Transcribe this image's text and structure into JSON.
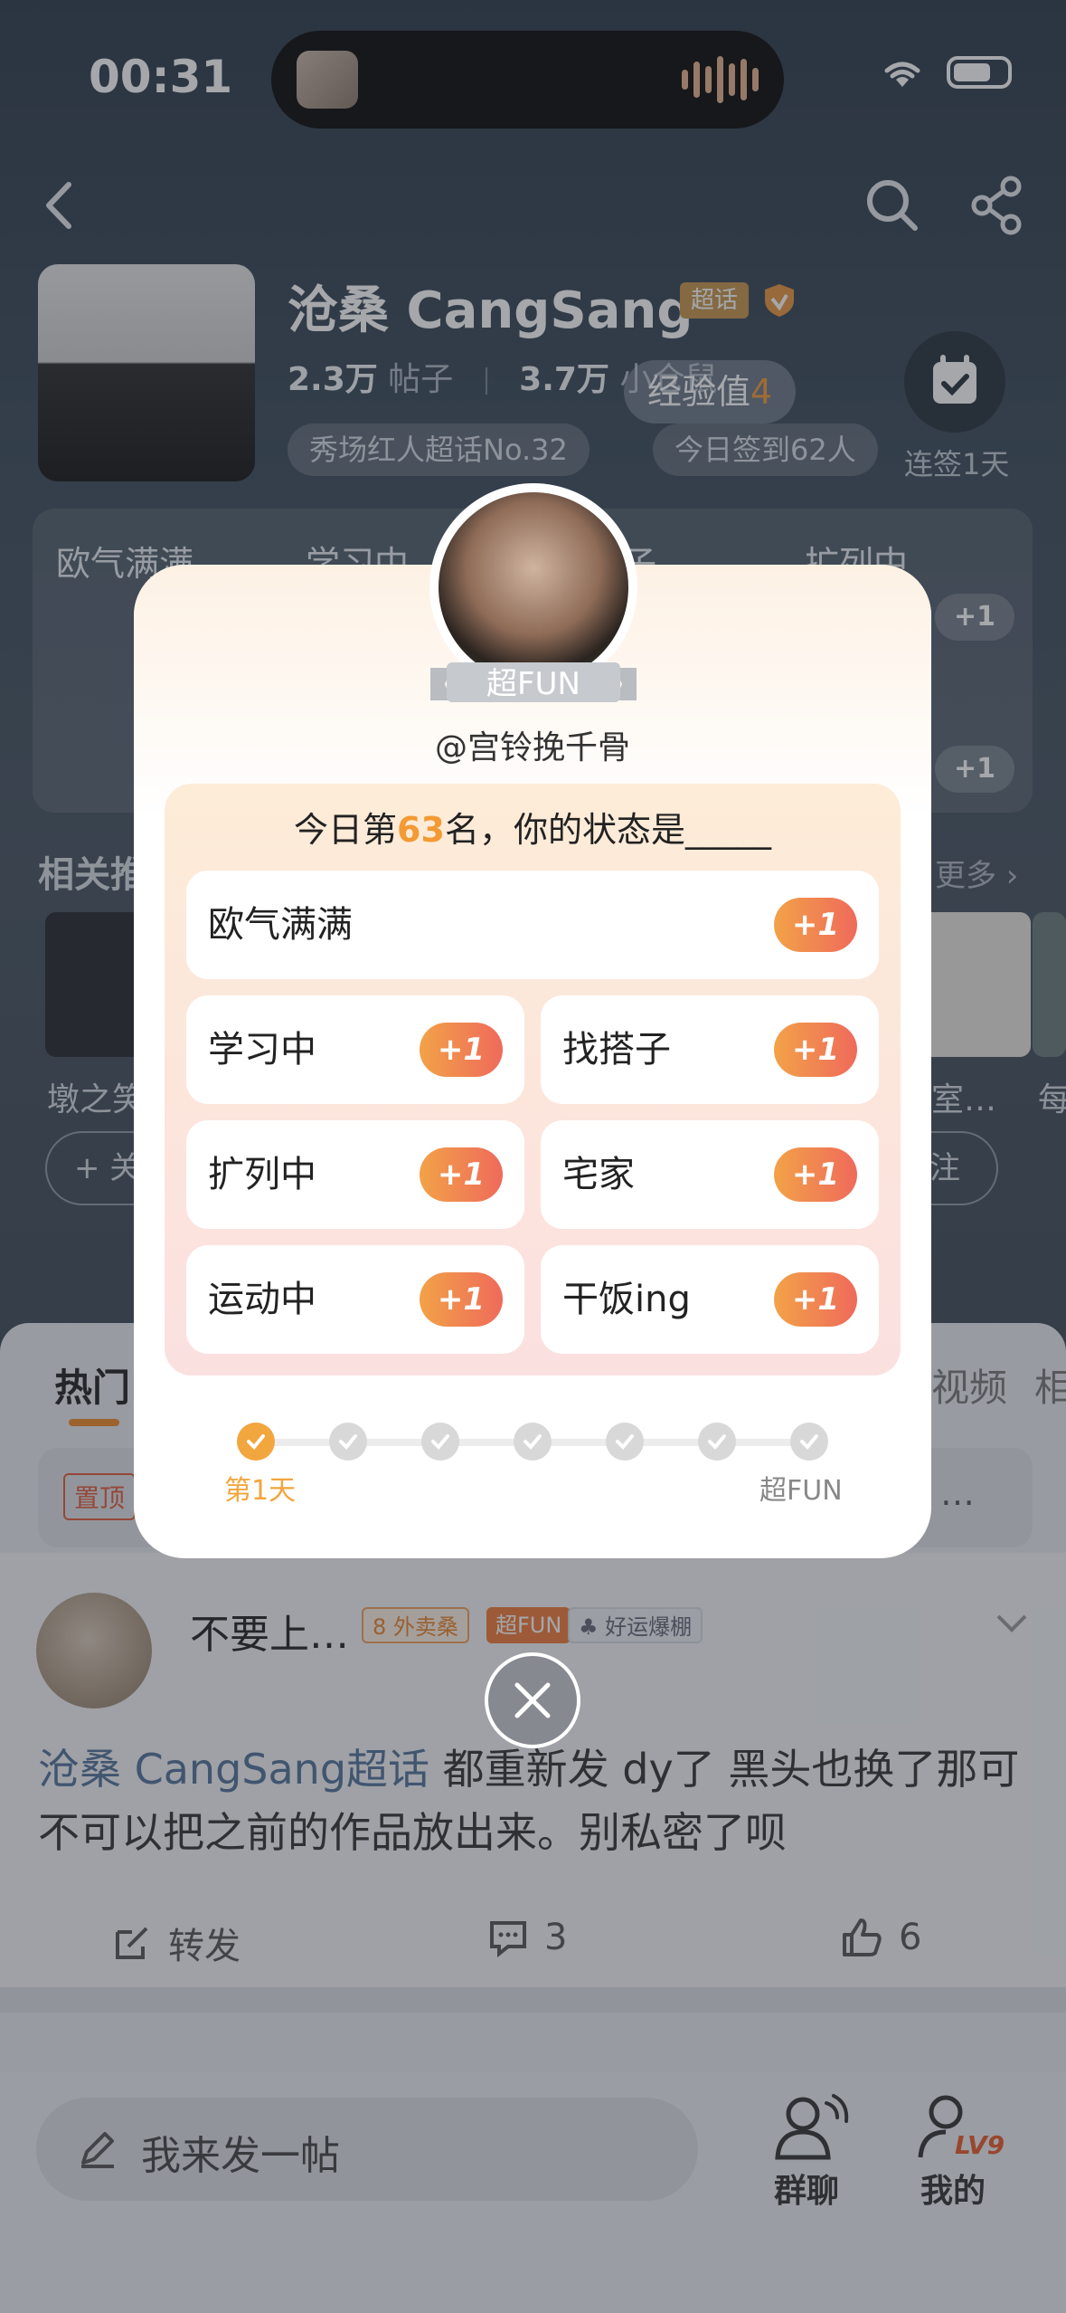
{
  "status_bar": {
    "time": "00:31"
  },
  "topic": {
    "title": "沧桑 CangSang",
    "tag": "超话",
    "posts_count": "2.3万",
    "posts_label": "帖子",
    "members_count": "3.7万",
    "members_label": "小仓鼠",
    "rank_pill": "秀场红人超话No.32",
    "checkin_pill": "今日签到62人",
    "streak_label": "连签1天",
    "exp_label": "经验值",
    "exp_value": "4"
  },
  "status_board": {
    "columns": [
      "欧气满满",
      "学习中",
      "找搭子",
      "扩列中"
    ],
    "plus": "+1"
  },
  "related": {
    "title": "相关推",
    "more": "更多 ›",
    "names": [
      "墩之笑",
      "室…",
      "每"
    ],
    "follow_label": "+ 关",
    "follow_label_right": "注"
  },
  "feed_tabs": [
    "热门",
    "视频",
    "相"
  ],
  "pinned": {
    "tag": "置顶",
    "tail": "…"
  },
  "post": {
    "user": "不要上…",
    "badge_takeout": "外卖桑",
    "badge_takeout_level": "8",
    "badge_fun": "超FUN",
    "badge_luck": "好运爆棚",
    "topic_link": "沧桑 CangSang超话",
    "text": "都重新发 dy了 黑头也换了那可不可以把之前的作品放出来。别私密了呗",
    "repost_label": "转发",
    "comments": "3",
    "likes": "6"
  },
  "bottom_bar": {
    "compose_placeholder": "我来发一帖",
    "group_chat": "群聊",
    "mine": "我的",
    "level": "LV9"
  },
  "modal": {
    "fun_ribbon": "超FUN",
    "handle": "@宫铃挽千骨",
    "rank_prefix": "今日第",
    "rank_value": "63",
    "rank_suffix": "名，你的状态是_____",
    "options": [
      {
        "label": "欧气满满",
        "plus": "+1"
      },
      {
        "label": "学习中",
        "plus": "+1"
      },
      {
        "label": "找搭子",
        "plus": "+1"
      },
      {
        "label": "扩列中",
        "plus": "+1"
      },
      {
        "label": "宅家",
        "plus": "+1"
      },
      {
        "label": "运动中",
        "plus": "+1"
      },
      {
        "label": "干饭ing",
        "plus": "+1"
      }
    ],
    "progress": {
      "current_day": 1,
      "total_days": 7,
      "start_label": "第1天",
      "end_label": "超FUN"
    }
  },
  "colors": {
    "accent_orange": "#f39a34",
    "plus_gradient_start": "#f2a248",
    "plus_gradient_end": "#ef6a5b",
    "topic_link": "#54739a"
  }
}
